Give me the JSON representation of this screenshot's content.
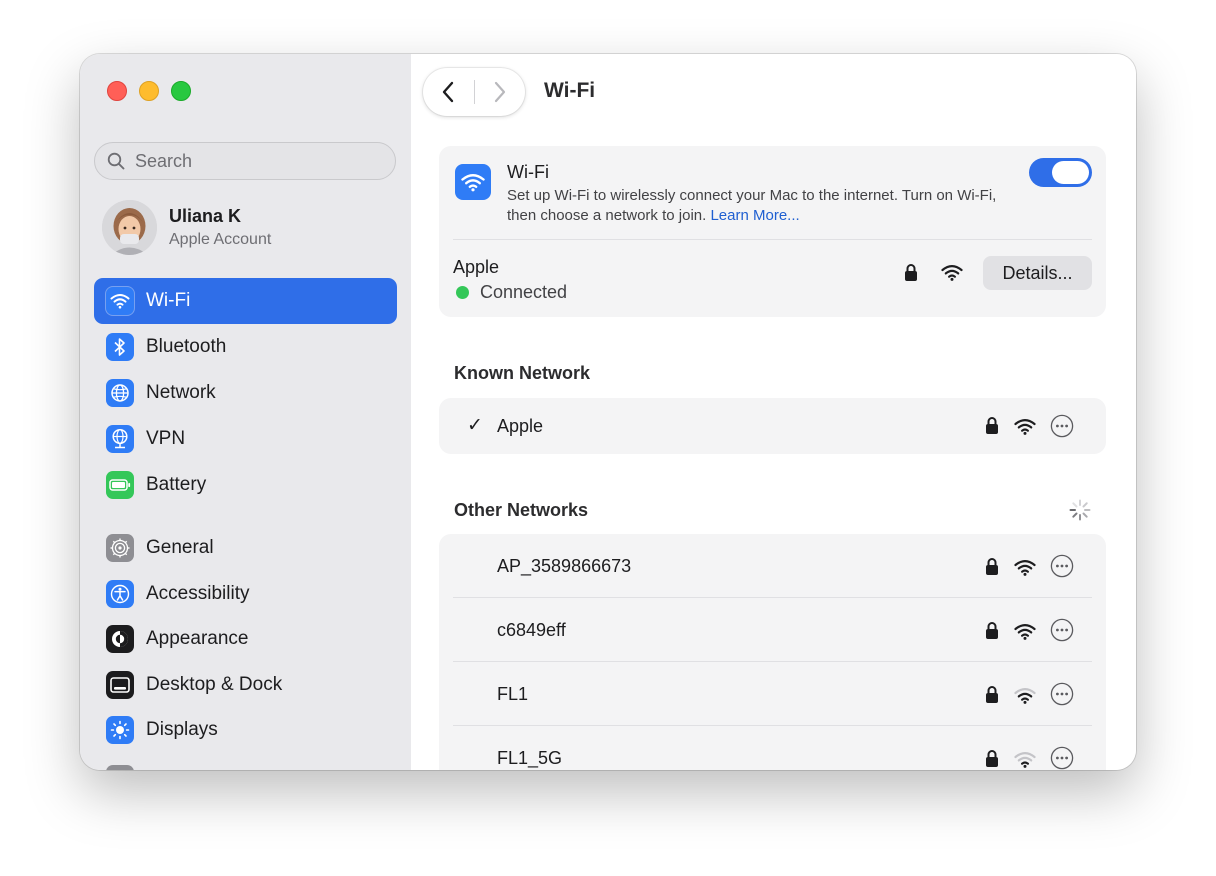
{
  "sidebar": {
    "search_placeholder": "Search",
    "account": {
      "name": "Uliana K",
      "subtitle": "Apple Account"
    },
    "items": [
      {
        "label": "Wi-Fi",
        "icon": "wifi-icon",
        "color": "#2f7cf6",
        "active": true
      },
      {
        "label": "Bluetooth",
        "icon": "bluetooth-icon",
        "color": "#2f7cf6"
      },
      {
        "label": "Network",
        "icon": "globe-icon",
        "color": "#2f7cf6"
      },
      {
        "label": "VPN",
        "icon": "vpn-globe-icon",
        "color": "#2f7cf6"
      },
      {
        "label": "Battery",
        "icon": "battery-icon",
        "color": "#34c759"
      },
      {
        "label": "General",
        "icon": "gear-icon",
        "color": "#8e8e93"
      },
      {
        "label": "Accessibility",
        "icon": "accessibility-icon",
        "color": "#2f7cf6"
      },
      {
        "label": "Appearance",
        "icon": "appearance-icon",
        "color": "#1c1c1e"
      },
      {
        "label": "Desktop & Dock",
        "icon": "dock-icon",
        "color": "#1c1c1e"
      },
      {
        "label": "Displays",
        "icon": "sun-icon",
        "color": "#2f7cf6"
      }
    ]
  },
  "header": {
    "title": "Wi-Fi"
  },
  "wifi_card": {
    "title": "Wi-Fi",
    "description": "Set up Wi-Fi to wirelessly connect your Mac to the internet. Turn on Wi-Fi, then choose a network to join.",
    "learn_more": "Learn More...",
    "toggle_on": true,
    "current_network": "Apple",
    "status": "Connected",
    "details_label": "Details..."
  },
  "known": {
    "title": "Known Network",
    "network": {
      "check": "✓",
      "name": "Apple"
    }
  },
  "other": {
    "title": "Other Networks",
    "networks": [
      {
        "name": "AP_3589866673",
        "signal": "strong"
      },
      {
        "name": "c6849eff",
        "signal": "strong"
      },
      {
        "name": "FL1",
        "signal": "medium"
      },
      {
        "name": "FL1_5G",
        "signal": "weak"
      }
    ]
  },
  "colors": {
    "accent": "#2f6ee8",
    "connected": "#34c759",
    "link": "#1f5fd1"
  }
}
